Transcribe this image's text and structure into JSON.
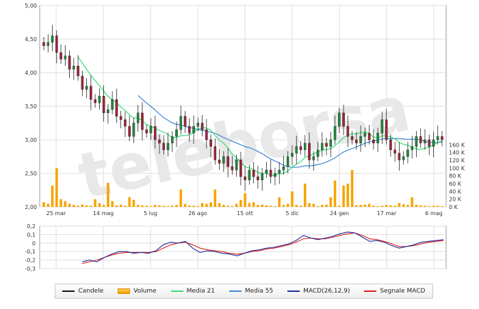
{
  "chart_data": {
    "type": "candlestick",
    "x_tick_labels": [
      "25 mar",
      "14 mag",
      "5 lug",
      "26 ago",
      "15 ott",
      "5 dic",
      "24 gen",
      "17 mar",
      "6 mag"
    ],
    "price_panel": {
      "ylim": [
        2.0,
        5.0
      ],
      "y_tick_labels": [
        "2,00",
        "2,50",
        "3,00",
        "3,50",
        "4,00",
        "4,50",
        "5,00"
      ],
      "volume_ylim": [
        0,
        180000
      ],
      "volume_tick_labels": [
        "0 K",
        "20 K",
        "40 K",
        "60 K",
        "80 K",
        "100 K",
        "120 K",
        "140 K",
        "160 K"
      ],
      "close": [
        4.4,
        4.45,
        4.55,
        4.3,
        4.2,
        4.25,
        4.05,
        4.1,
        3.95,
        3.75,
        3.8,
        3.6,
        3.55,
        3.65,
        3.4,
        3.45,
        3.6,
        3.35,
        3.3,
        3.2,
        3.05,
        3.25,
        3.4,
        3.15,
        3.1,
        3.2,
        3.0,
        2.95,
        2.85,
        2.95,
        3.05,
        3.15,
        3.35,
        3.2,
        3.1,
        3.2,
        3.25,
        3.15,
        3.0,
        2.9,
        2.7,
        2.65,
        2.75,
        2.6,
        2.55,
        2.7,
        2.45,
        2.4,
        2.55,
        2.45,
        2.4,
        2.5,
        2.55,
        2.45,
        2.5,
        2.55,
        2.6,
        2.75,
        2.8,
        2.9,
        2.85,
        2.95,
        2.7,
        2.75,
        2.85,
        2.95,
        2.9,
        3.0,
        3.2,
        3.4,
        3.2,
        3.05,
        3.0,
        2.95,
        3.05,
        3.1,
        3.0,
        2.95,
        3.1,
        3.3,
        3.0,
        2.85,
        2.8,
        2.7,
        2.75,
        2.85,
        2.9,
        3.05,
        2.95,
        3.0,
        2.9,
        3.0,
        3.05,
        3.0
      ],
      "volume": [
        12000,
        8000,
        55000,
        100000,
        20000,
        15000,
        8000,
        5000,
        3000,
        6000,
        4000,
        3000,
        20000,
        10000,
        5000,
        62000,
        15000,
        4000,
        6000,
        3000,
        25000,
        18000,
        5000,
        4000,
        3000,
        2000,
        5000,
        4000,
        3000,
        2000,
        3000,
        5000,
        45000,
        8000,
        4000,
        3000,
        2000,
        10000,
        8000,
        12000,
        45000,
        10000,
        5000,
        3000,
        2000,
        8000,
        18000,
        35000,
        10000,
        12000,
        5000,
        6000,
        4000,
        3000,
        2000,
        25000,
        5000,
        8000,
        40000,
        5000,
        3000,
        60000,
        10000,
        8000,
        2000,
        5000,
        6000,
        25000,
        68000,
        3000,
        55000,
        60000,
        95000,
        4000,
        5000,
        6000,
        8000,
        3000,
        2000,
        3000,
        5000,
        4000,
        3000,
        10000,
        7000,
        5000,
        25000,
        6000,
        4000,
        3000,
        2000,
        3000,
        3000,
        2000
      ]
    },
    "macd_panel": {
      "ylim": [
        -0.3,
        0.2
      ],
      "y_tick_labels": [
        "-0,3",
        "-0,2",
        "-0,1",
        "0",
        "0,1",
        "0,2"
      ],
      "macd": [
        -0.22,
        -0.2,
        -0.22,
        -0.17,
        -0.13,
        -0.1,
        -0.1,
        -0.12,
        -0.11,
        -0.12,
        -0.09,
        -0.02,
        0.01,
        0.0,
        0.02,
        -0.06,
        -0.11,
        -0.09,
        -0.1,
        -0.12,
        -0.13,
        -0.15,
        -0.12,
        -0.09,
        -0.08,
        -0.06,
        -0.05,
        -0.03,
        -0.01,
        0.03,
        0.09,
        0.06,
        0.04,
        0.06,
        0.08,
        0.11,
        0.13,
        0.12,
        0.07,
        0.02,
        0.03,
        0.01,
        -0.03,
        -0.06,
        -0.04,
        -0.02,
        0.01,
        0.02,
        0.03,
        0.04
      ],
      "signal": [
        -0.24,
        -0.22,
        -0.2,
        -0.17,
        -0.14,
        -0.12,
        -0.11,
        -0.11,
        -0.11,
        -0.11,
        -0.1,
        -0.06,
        -0.02,
        0.0,
        0.01,
        -0.02,
        -0.06,
        -0.08,
        -0.09,
        -0.1,
        -0.12,
        -0.13,
        -0.12,
        -0.1,
        -0.09,
        -0.07,
        -0.06,
        -0.04,
        -0.02,
        0.01,
        0.05,
        0.06,
        0.05,
        0.05,
        0.07,
        0.09,
        0.11,
        0.12,
        0.09,
        0.05,
        0.04,
        0.02,
        -0.01,
        -0.04,
        -0.04,
        -0.03,
        -0.01,
        0.01,
        0.02,
        0.03
      ]
    },
    "legend": [
      {
        "label": "Candele",
        "color": "#111111",
        "kind": "line",
        "icon": "candle-icon"
      },
      {
        "label": "Volume",
        "color": "#f7a400",
        "kind": "box",
        "icon": "volume-icon"
      },
      {
        "label": "Media 21",
        "color": "#33dd77",
        "kind": "line",
        "icon": "ma21-icon"
      },
      {
        "label": "Media 55",
        "color": "#3a86d4",
        "kind": "line",
        "icon": "ma55-icon"
      },
      {
        "label": "MACD(26,12,9)",
        "color": "#1a2a9a",
        "kind": "line",
        "icon": "macd-icon"
      },
      {
        "label": "Segnale MACD",
        "color": "#e01b1b",
        "kind": "line",
        "icon": "signal-icon"
      }
    ],
    "watermark": "teleborsa",
    "colors": {
      "up": "#1f8a3a",
      "down": "#a0233a",
      "volume": "#f7a400",
      "grid": "#dddddd"
    },
    "grid": true
  }
}
